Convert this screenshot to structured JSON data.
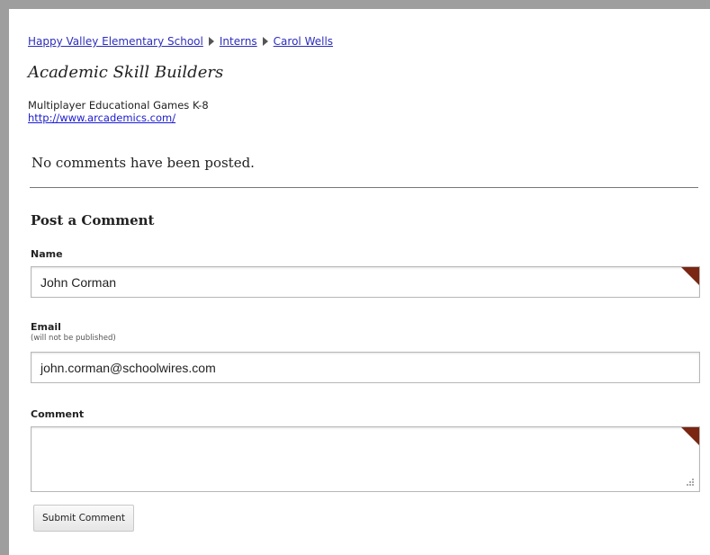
{
  "breadcrumb": {
    "items": [
      "Happy Valley Elementary School",
      "Interns",
      "Carol Wells"
    ]
  },
  "page": {
    "title": "Academic Skill Builders",
    "description": "Multiplayer Educational Games K-8",
    "link": "http://www.arcademics.com/"
  },
  "comments": {
    "empty_message": "No comments have been posted."
  },
  "form": {
    "heading": "Post a Comment",
    "name_label": "Name",
    "name_value": "John Corman",
    "email_label": "Email",
    "email_note": "(will not be published)",
    "email_value": "john.corman@schoolwires.com",
    "comment_label": "Comment",
    "comment_value": "",
    "submit_label": "Submit Comment"
  },
  "colors": {
    "frame": "#9e9e9e",
    "link": "#2d2dbd",
    "required_marker": "#7a2612"
  }
}
